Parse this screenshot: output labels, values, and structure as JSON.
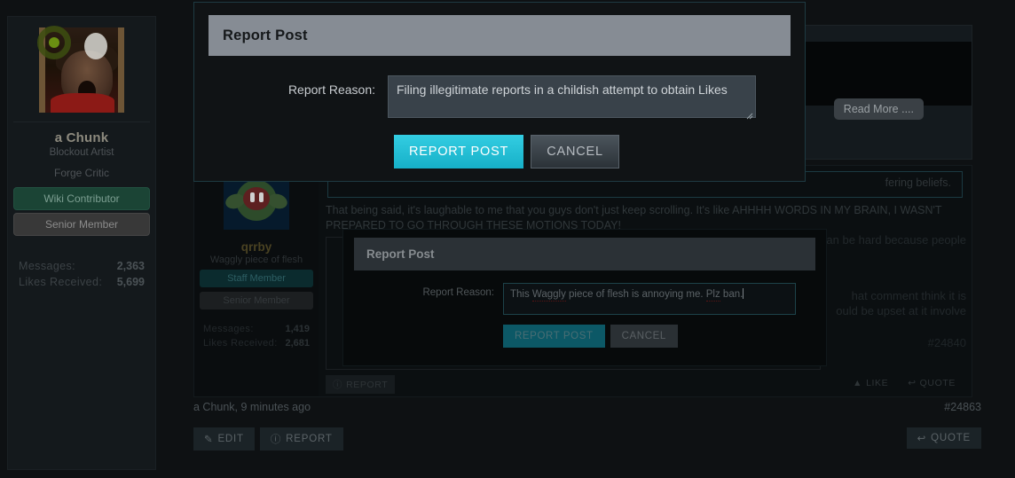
{
  "profile": {
    "username": "a Chunk",
    "user_title": "Blockout Artist",
    "rank": "Forge Critic",
    "badges": [
      {
        "label": "Wiki Contributor",
        "color": "#1b4435"
      },
      {
        "label": "Senior Member",
        "color": "#383838"
      }
    ],
    "stats": [
      {
        "label": "Messages:",
        "value": "2,363"
      },
      {
        "label": "Likes Received:",
        "value": "5,699"
      }
    ]
  },
  "post_top": {
    "read_more_label": "Read More ...."
  },
  "post_quoted": {
    "username": "qrrby",
    "user_title": "Waggly piece of flesh",
    "badges": [
      {
        "label": "Staff Member",
        "color": "#0b2b2e"
      },
      {
        "label": "Senior Member",
        "color": "#1c1f21"
      }
    ],
    "stats": [
      {
        "label": "Messages:",
        "value": "1,419"
      },
      {
        "label": "Likes Received:",
        "value": "2,681"
      }
    ],
    "quote_tail": "fering beliefs.",
    "body": "That being said, it's laughable to me that you guys don't just keep scrolling. It's like AHHHH WORDS IN MY BRAIN, I WASN'T PREPARED TO GO THROUGH THESE MOTIONS TODAY!",
    "right_fragments": [
      "an be hard because people",
      "hat comment think it is",
      "ould be upset at it involve"
    ],
    "post_id": "#24840",
    "report_label": "REPORT",
    "like_label": "LIKE",
    "quote_label": "QUOTE"
  },
  "post_bottom": {
    "meta": "a Chunk, 9 minutes ago",
    "post_id": "#24863",
    "edit_label": "EDIT",
    "report_label": "REPORT",
    "quote_label": "QUOTE"
  },
  "modal_active": {
    "title": "Report Post",
    "reason_label": "Report Reason:",
    "reason_value": "Filing illegitimate reports in a childish attempt to obtain Likes",
    "submit_label": "REPORT POST",
    "cancel_label": "CANCEL",
    "accent_color": "#21becf",
    "header_color": "#868c94"
  },
  "modal_behind": {
    "title": "Report Post",
    "reason_label": "Report Reason:",
    "reason_part1": "This ",
    "reason_misspell1": "Waggly",
    "reason_part2": " piece of flesh is annoying me.  ",
    "reason_misspell2": "Plz",
    "reason_part3": " ban.",
    "reason_value": "This Waggly piece of flesh is annoying me.  Plz ban.",
    "submit_label": "REPORT POST",
    "cancel_label": "CANCEL"
  },
  "icons": {
    "edit": "✎",
    "report": "ⓘ",
    "like": "▲",
    "quote": "↩"
  }
}
